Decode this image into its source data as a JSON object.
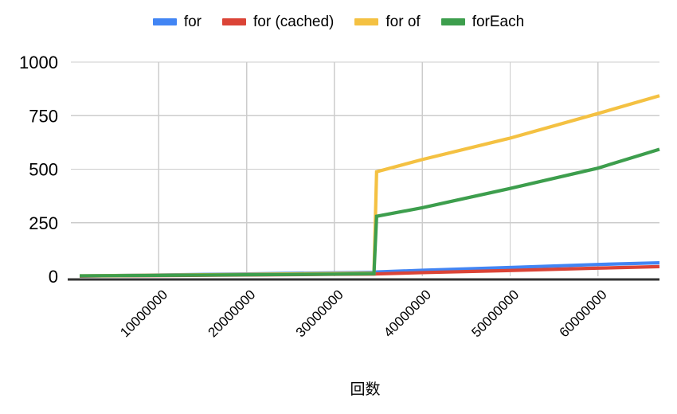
{
  "chart_data": {
    "type": "line",
    "title": "",
    "xlabel": "回数",
    "ylabel": "",
    "xlim": [
      0,
      67000000
    ],
    "ylim": [
      0,
      1000
    ],
    "grid": true,
    "legend_position": "top-center",
    "x_tick_labels": [
      "10000000",
      "20000000",
      "30000000",
      "40000000",
      "50000000",
      "60000000"
    ],
    "x_ticks": [
      10000000,
      20000000,
      30000000,
      40000000,
      50000000,
      60000000
    ],
    "y_tick_labels": [
      "0",
      "250",
      "500",
      "750",
      "1000"
    ],
    "y_ticks": [
      0,
      250,
      500,
      750,
      1000
    ],
    "series": [
      {
        "name": "for",
        "color": "#4285f4",
        "x": [
          1000000,
          10000000,
          20000000,
          30000000,
          34500000,
          34800000,
          40000000,
          50000000,
          60000000,
          67000000
        ],
        "values": [
          1,
          6,
          11,
          16,
          18,
          20,
          28,
          41,
          55,
          63
        ]
      },
      {
        "name": "for (cached)",
        "color": "#db4437",
        "x": [
          1000000,
          10000000,
          20000000,
          30000000,
          34500000,
          34800000,
          40000000,
          50000000,
          60000000,
          67000000
        ],
        "values": [
          1,
          3,
          6,
          9,
          10,
          11,
          17,
          27,
          38,
          45
        ]
      },
      {
        "name": "for of",
        "color": "#f4c142",
        "x": [
          1000000,
          10000000,
          20000000,
          30000000,
          34500000,
          34800000,
          40000000,
          50000000,
          60000000,
          67000000
        ],
        "values": [
          2,
          5,
          9,
          13,
          15,
          488,
          545,
          645,
          760,
          843
        ]
      },
      {
        "name": "forEach",
        "color": "#3d9e4d",
        "x": [
          1000000,
          10000000,
          20000000,
          30000000,
          34500000,
          34800000,
          40000000,
          50000000,
          60000000,
          67000000
        ],
        "values": [
          2,
          4,
          7,
          10,
          12,
          280,
          320,
          410,
          505,
          593
        ]
      }
    ]
  },
  "legend": {
    "items": [
      {
        "label": "for",
        "color": "#4285f4"
      },
      {
        "label": "for (cached)",
        "color": "#db4437"
      },
      {
        "label": "for of",
        "color": "#f4c142"
      },
      {
        "label": "forEach",
        "color": "#3d9e4d"
      }
    ]
  },
  "axis": {
    "x_title": "回数"
  }
}
